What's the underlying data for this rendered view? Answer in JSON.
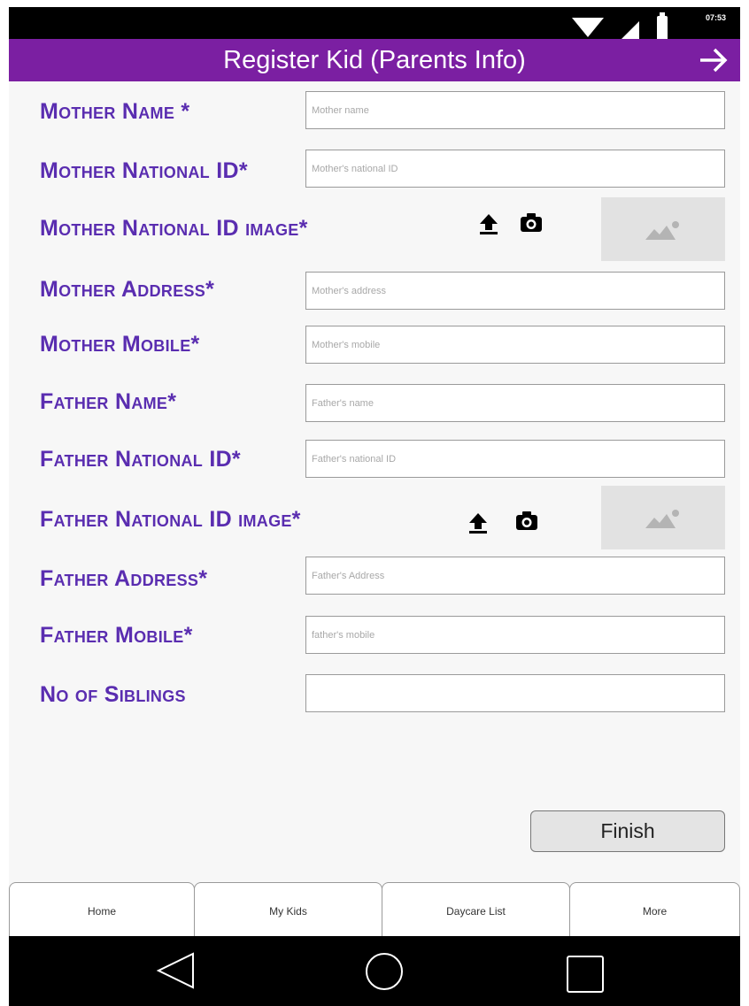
{
  "status_bar": {
    "time": "07:53"
  },
  "app_bar": {
    "title": "Register Kid (Parents Info)",
    "next_icon": "arrow-right-icon"
  },
  "form": {
    "mother_name": {
      "label": "Mother Name *",
      "placeholder": "Mother name"
    },
    "mother_national_id": {
      "label": "Mother National ID*",
      "placeholder": "Mother's national ID"
    },
    "mother_national_id_image": {
      "label": "Mother National ID image*",
      "upload_icon": "upload-icon",
      "camera_icon": "camera-icon",
      "image_icon": "image-placeholder-icon"
    },
    "mother_address": {
      "label": "Mother Address*",
      "placeholder": "Mother's address"
    },
    "mother_mobile": {
      "label": "Mother Mobile*",
      "placeholder": "Mother's mobile"
    },
    "father_name": {
      "label": "Father Name*",
      "placeholder": "Father's name"
    },
    "father_national_id": {
      "label": "Father National ID*",
      "placeholder": "Father's national ID"
    },
    "father_national_id_image": {
      "label": "Father National ID image*",
      "upload_icon": "upload-icon",
      "camera_icon": "camera-icon",
      "image_icon": "image-placeholder-icon"
    },
    "father_address": {
      "label": "Father Address*",
      "placeholder": "Father's Address"
    },
    "father_mobile": {
      "label": "Father Mobile*",
      "placeholder": "father's mobile"
    },
    "no_of_siblings": {
      "label": "No of Siblings",
      "placeholder": ""
    },
    "finish_label": "Finish"
  },
  "tabs": [
    {
      "label": "Home"
    },
    {
      "label": "My Kids"
    },
    {
      "label": "Daycare List"
    },
    {
      "label": "More"
    }
  ],
  "nav_bar": {
    "back_icon": "back-triangle-icon",
    "home_icon": "home-circle-icon",
    "recents_icon": "recents-square-icon"
  },
  "colors": {
    "app_bar": "#7b1fa2",
    "label": "#5a2db0",
    "background": "#f7f7f7"
  }
}
